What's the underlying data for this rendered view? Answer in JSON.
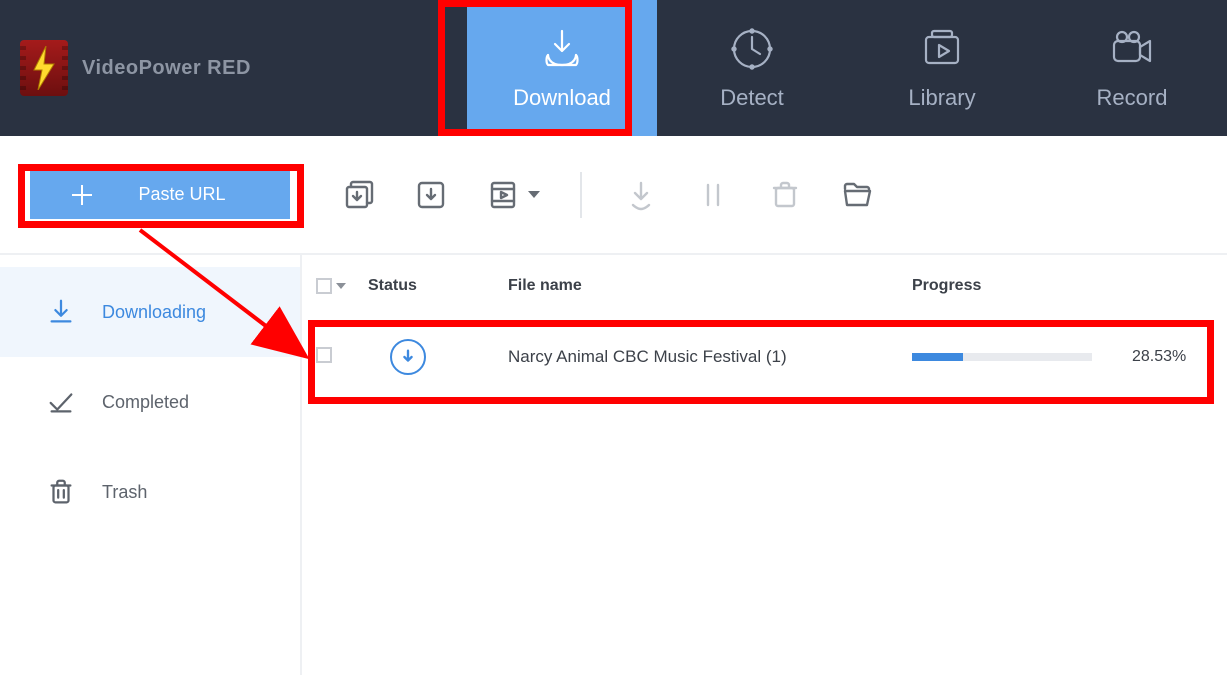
{
  "app": {
    "title": "VideoPower RED"
  },
  "header_tabs": {
    "download": "Download",
    "detect": "Detect",
    "library": "Library",
    "record": "Record"
  },
  "toolbar": {
    "paste_url_label": "Paste URL"
  },
  "sidebar": {
    "items": [
      {
        "id": "downloading",
        "label": "Downloading"
      },
      {
        "id": "completed",
        "label": "Completed"
      },
      {
        "id": "trash",
        "label": "Trash"
      }
    ]
  },
  "table": {
    "headers": {
      "status": "Status",
      "filename": "File name",
      "progress": "Progress"
    },
    "rows": [
      {
        "status": "downloading",
        "filename": "Narcy  Animal  CBC Music Festival (1)",
        "progress_pct": 28.53,
        "progress_label": "28.53%"
      }
    ]
  },
  "colors": {
    "header_bg": "#2a3241",
    "accent": "#66a8ee",
    "accent2": "#3d89df",
    "annotation": "#ff0000"
  }
}
